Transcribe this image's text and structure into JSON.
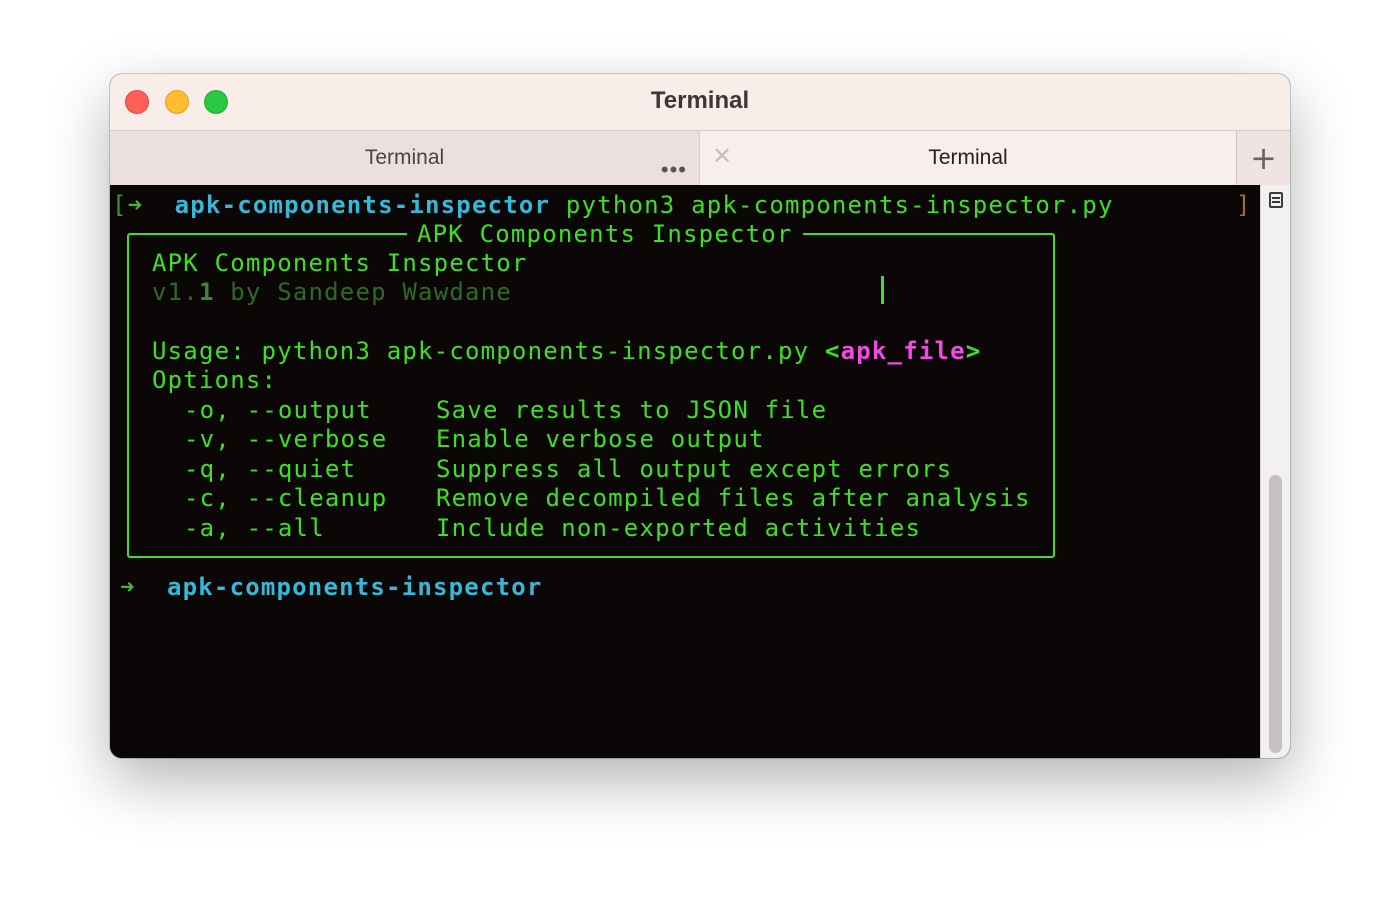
{
  "window": {
    "title": "Terminal"
  },
  "tabs": [
    {
      "label": "Terminal",
      "active": false
    },
    {
      "label": "Terminal",
      "active": true
    }
  ],
  "tab_icons": {
    "more": "ellipsis-icon",
    "close": "close-icon",
    "add": "plus-icon"
  },
  "terminal": {
    "prompt1": {
      "bracket_open": "[",
      "arrow": "➜",
      "dir": "apk-components-inspector",
      "command": "python3 apk-components-inspector.py",
      "bracket_close": "]"
    },
    "box_title": "APK Components Inspector",
    "banner_title": "APK Components Inspector",
    "version": "v1.",
    "version_num": "1",
    "author": "by Sandeep Wawdane",
    "usage_prefix": "Usage: python3 apk-components-inspector.py",
    "usage_arg": "<apk_file>",
    "options_label": "Options:",
    "options": [
      {
        "flag": "-o, --output",
        "desc": "Save results to JSON file"
      },
      {
        "flag": "-v, --verbose",
        "desc": "Enable verbose output"
      },
      {
        "flag": "-q, --quiet",
        "desc": "Suppress all output except errors"
      },
      {
        "flag": "-c, --cleanup",
        "desc": "Remove decompiled files after analysis"
      },
      {
        "flag": "-a, --all",
        "desc": "Include non-exported activities"
      }
    ],
    "prompt2": {
      "arrow": "➜",
      "dir": "apk-components-inspector"
    }
  },
  "colors": {
    "green": "#3fe024",
    "cyan": "#37b8d8",
    "magenta": "#f24ae6",
    "background": "#0b0706"
  }
}
